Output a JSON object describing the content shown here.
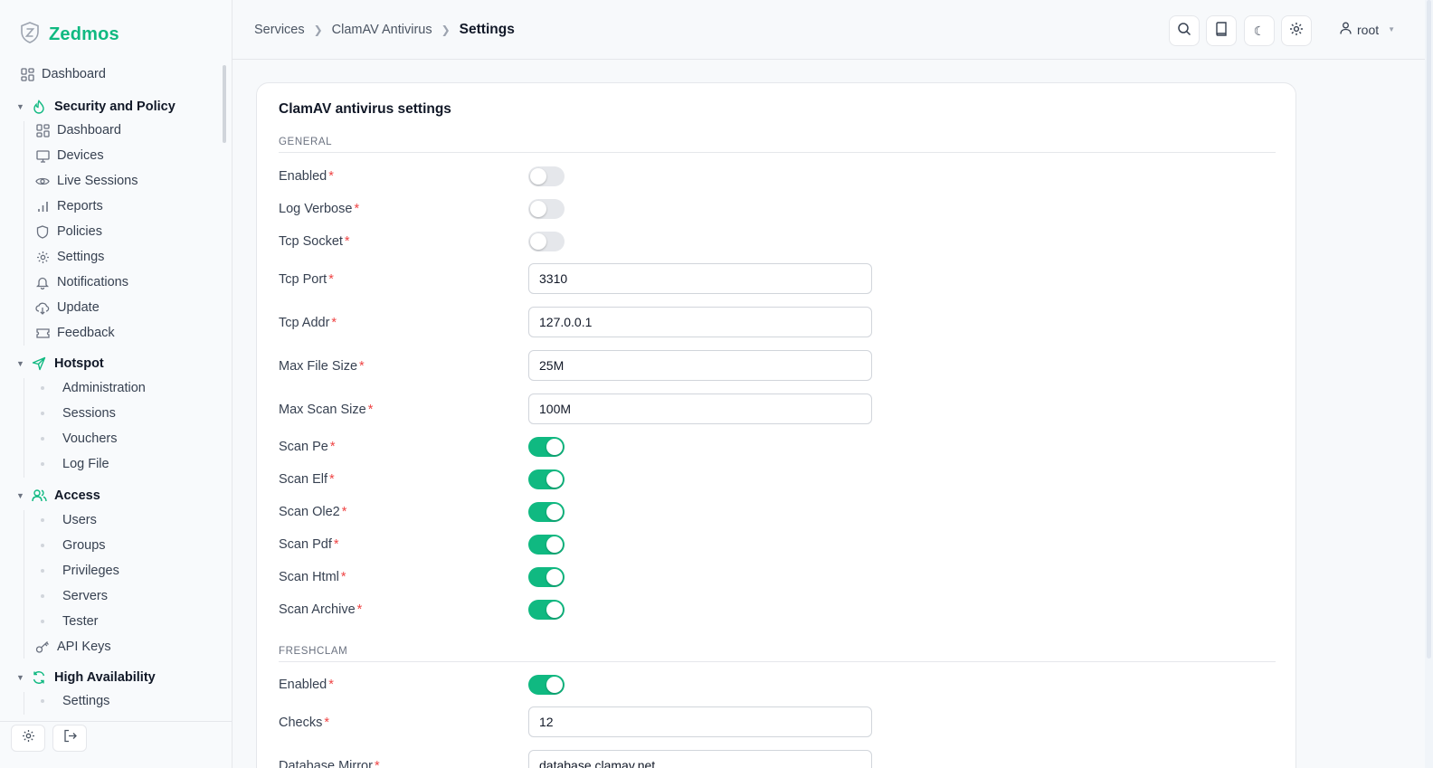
{
  "brand": {
    "name": "Zedmos",
    "logo_icon": "shield-z-icon",
    "accent": "#10b981"
  },
  "sidebar": {
    "top_item": {
      "label": "Dashboard",
      "icon": "dashboard-icon"
    },
    "groups": [
      {
        "label": "Security and Policy",
        "icon": "flame-icon",
        "items": [
          {
            "label": "Dashboard",
            "icon": "dashboard-icon"
          },
          {
            "label": "Devices",
            "icon": "monitor-icon"
          },
          {
            "label": "Live Sessions",
            "icon": "eye-icon"
          },
          {
            "label": "Reports",
            "icon": "bar-chart-icon"
          },
          {
            "label": "Policies",
            "icon": "shield-icon"
          },
          {
            "label": "Settings",
            "icon": "gear-icon"
          },
          {
            "label": "Notifications",
            "icon": "bell-icon"
          },
          {
            "label": "Update",
            "icon": "cloud-download-icon"
          },
          {
            "label": "Feedback",
            "icon": "ticket-icon"
          }
        ]
      },
      {
        "label": "Hotspot",
        "icon": "send-icon",
        "items": [
          {
            "label": "Administration"
          },
          {
            "label": "Sessions"
          },
          {
            "label": "Vouchers"
          },
          {
            "label": "Log File"
          }
        ]
      },
      {
        "label": "Access",
        "icon": "users-icon",
        "items": [
          {
            "label": "Users"
          },
          {
            "label": "Groups"
          },
          {
            "label": "Privileges"
          },
          {
            "label": "Servers"
          },
          {
            "label": "Tester"
          },
          {
            "label": "API Keys",
            "icon": "key-icon"
          }
        ]
      },
      {
        "label": "High Availability",
        "icon": "refresh-icon",
        "items": [
          {
            "label": "Settings"
          }
        ]
      }
    ],
    "footer": {
      "settings_icon": "gear-icon",
      "logout_icon": "logout-icon"
    }
  },
  "header": {
    "breadcrumb": [
      "Services",
      "ClamAV Antivirus",
      "Settings"
    ],
    "buttons": [
      "search-icon",
      "book-icon",
      "moon-icon",
      "gear-icon"
    ],
    "user": {
      "name": "root",
      "icon": "user-icon"
    }
  },
  "card": {
    "title": "ClamAV antivirus settings",
    "sections": {
      "general": "GENERAL",
      "freshclam": "FRESHCLAM"
    },
    "general": [
      {
        "label": "Enabled",
        "type": "toggle",
        "value": false
      },
      {
        "label": "Log Verbose",
        "type": "toggle",
        "value": false
      },
      {
        "label": "Tcp Socket",
        "type": "toggle",
        "value": false
      },
      {
        "label": "Tcp Port",
        "type": "text",
        "value": "3310"
      },
      {
        "label": "Tcp Addr",
        "type": "text",
        "value": "127.0.0.1"
      },
      {
        "label": "Max File Size",
        "type": "text",
        "value": "25M"
      },
      {
        "label": "Max Scan Size",
        "type": "text",
        "value": "100M"
      },
      {
        "label": "Scan Pe",
        "type": "toggle",
        "value": true
      },
      {
        "label": "Scan Elf",
        "type": "toggle",
        "value": true
      },
      {
        "label": "Scan Ole2",
        "type": "toggle",
        "value": true
      },
      {
        "label": "Scan Pdf",
        "type": "toggle",
        "value": true
      },
      {
        "label": "Scan Html",
        "type": "toggle",
        "value": true
      },
      {
        "label": "Scan Archive",
        "type": "toggle",
        "value": true
      }
    ],
    "freshclam": [
      {
        "label": "Enabled",
        "type": "toggle",
        "value": true
      },
      {
        "label": "Checks",
        "type": "text",
        "value": "12"
      },
      {
        "label": "Database Mirror",
        "type": "text",
        "value": "database.clamav.net"
      }
    ]
  }
}
